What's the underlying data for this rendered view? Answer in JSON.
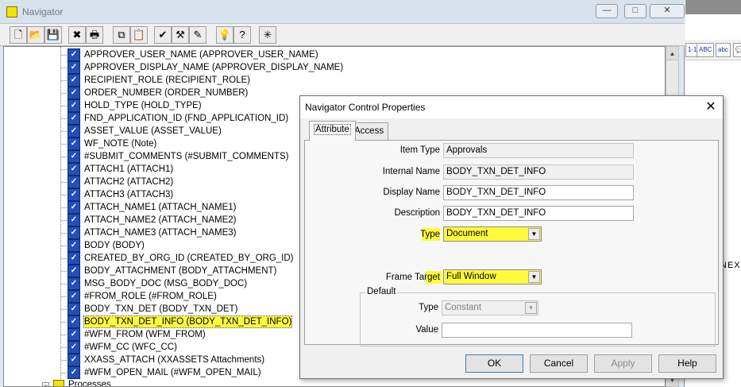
{
  "window": {
    "title": "Navigator",
    "minimize_glyph": "—",
    "maximize_glyph": "□",
    "close_glyph": "✕"
  },
  "toolbar": {
    "buttons": [
      {
        "name": "new-button",
        "glyph": "🗋"
      },
      {
        "name": "open-button",
        "glyph": "📂"
      },
      {
        "name": "save-button",
        "glyph": "💾"
      },
      {
        "name": "delete-button",
        "glyph": "✖"
      },
      {
        "name": "print-button",
        "glyph": "🖶"
      },
      {
        "name": "copy-button",
        "glyph": "⧉"
      },
      {
        "name": "paste-button",
        "glyph": "📋"
      },
      {
        "name": "verify-button",
        "glyph": "✔"
      },
      {
        "name": "build-button",
        "glyph": "⚒"
      },
      {
        "name": "edit-button",
        "glyph": "✎"
      },
      {
        "name": "hint-button",
        "glyph": "💡"
      },
      {
        "name": "help-button",
        "glyph": "?"
      },
      {
        "name": "quick-start-button",
        "glyph": "✳"
      }
    ]
  },
  "tree": {
    "items": [
      "APPROVER_USER_NAME (APPROVER_USER_NAME)",
      "APPROVER_DISPLAY_NAME (APPROVER_DISPLAY_NAME)",
      "RECIPIENT_ROLE (RECIPIENT_ROLE)",
      "ORDER_NUMBER (ORDER_NUMBER)",
      "HOLD_TYPE (HOLD_TYPE)",
      "FND_APPLICATION_ID (FND_APPLICATION_ID)",
      "ASSET_VALUE (ASSET_VALUE)",
      "WF_NOTE (Note)",
      "#SUBMIT_COMMENTS (#SUBMIT_COMMENTS)",
      "ATTACH1 (ATTACH1)",
      "ATTACH2 (ATTACH2)",
      "ATTACH3 (ATTACH3)",
      "ATTACH_NAME1 (ATTACH_NAME1)",
      "ATTACH_NAME2 (ATTACH_NAME2)",
      "ATTACH_NAME3 (ATTACH_NAME3)",
      "BODY (BODY)",
      "CREATED_BY_ORG_ID (CREATED_BY_ORG_ID)",
      "BODY_ATTACHMENT (BODY_ATTACHMENT)",
      "MSG_BODY_DOC (MSG_BODY_DOC)",
      "#FROM_ROLE (#FROM_ROLE)",
      "BODY_TXN_DET (BODY_TXN_DET)",
      "BODY_TXN_DET_INFO (BODY_TXN_DET_INFO)",
      "#WFM_FROM (WFM_FROM)",
      "#WFM_CC (WFC_CC)",
      "XXASS_ATTACH (XXASSETS Attachments)",
      "#WFM_OPEN_MAIL (#WFM_OPEN_MAIL)"
    ],
    "selected_index": 21,
    "processes_label": "Processes",
    "processes_expander": "−"
  },
  "background": {
    "buttons": [
      "1-1",
      "ABC",
      "abc",
      "💬"
    ],
    "partial_text": "NEXT"
  },
  "dialog": {
    "title": "Navigator Control Properties",
    "close_glyph": "✕",
    "tabs": [
      "Attribute",
      "Access"
    ],
    "active_tab": "Attribute",
    "fields": {
      "item_type": {
        "label": "Item Type",
        "value": "Approvals"
      },
      "internal_name": {
        "label": "Internal Name",
        "value": "BODY_TXN_DET_INFO"
      },
      "display_name": {
        "label": "Display Name",
        "value": "BODY_TXN_DET_INFO"
      },
      "description": {
        "label": "Description",
        "value": "BODY_TXN_DET_INFO"
      },
      "type": {
        "label": "Type",
        "value": "Document"
      },
      "frame_target": {
        "label": "Frame Target",
        "value": "Full Window"
      }
    },
    "default_group": {
      "title": "Default",
      "type": {
        "label": "Type",
        "value": "Constant"
      },
      "value": {
        "label": "Value",
        "value": ""
      }
    },
    "buttons": {
      "ok": "OK",
      "cancel": "Cancel",
      "apply": "Apply",
      "help": "Help"
    },
    "highlight_color": "#fffb3a"
  }
}
